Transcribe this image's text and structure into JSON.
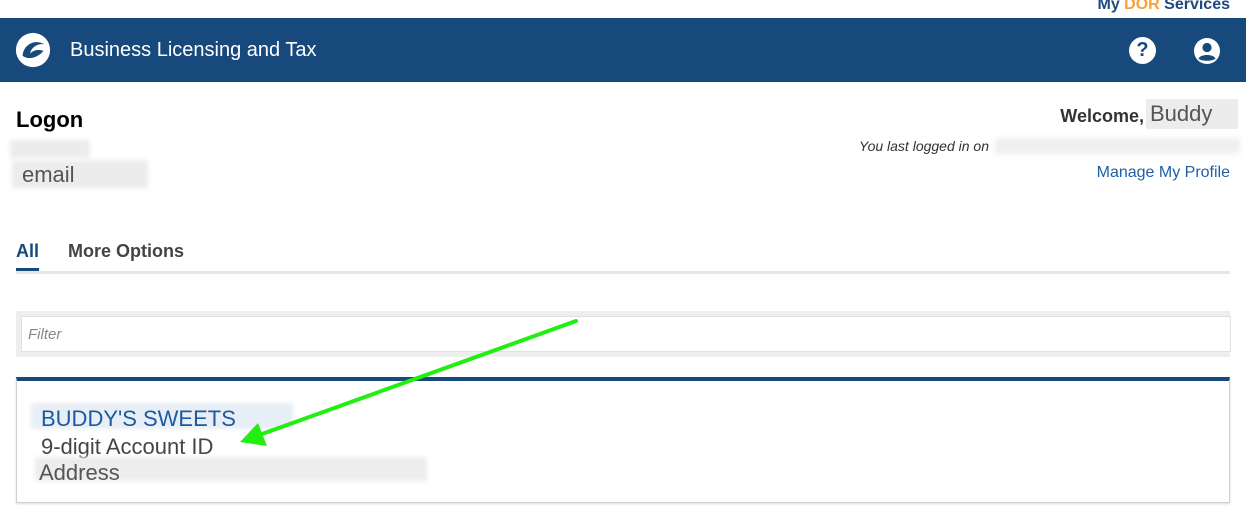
{
  "brand": {
    "prefix": "My ",
    "accent": "DOR",
    "suffix": " Services"
  },
  "header": {
    "title": "Business Licensing and Tax",
    "help_label": "?",
    "logo_icon": "dor-logo-icon",
    "user_icon": "user-circle-icon"
  },
  "session": {
    "page_title": "Logon",
    "email_label": "email",
    "welcome": "Welcome,",
    "username": "Buddy",
    "last_login_prefix": "You last logged in on",
    "manage_profile": "Manage My Profile"
  },
  "tabs": [
    {
      "label": "All",
      "active": true
    },
    {
      "label": "More Options",
      "active": false
    }
  ],
  "filter": {
    "placeholder": "Filter"
  },
  "accounts": [
    {
      "name": "BUDDY'S SWEETS",
      "account_id": "9-digit Account ID",
      "address": "Address"
    }
  ],
  "colors": {
    "header_bg": "#17497c",
    "accent_orange": "#f5a23a",
    "link_blue": "#1f5fa6",
    "annotation_green": "#22ee11"
  }
}
